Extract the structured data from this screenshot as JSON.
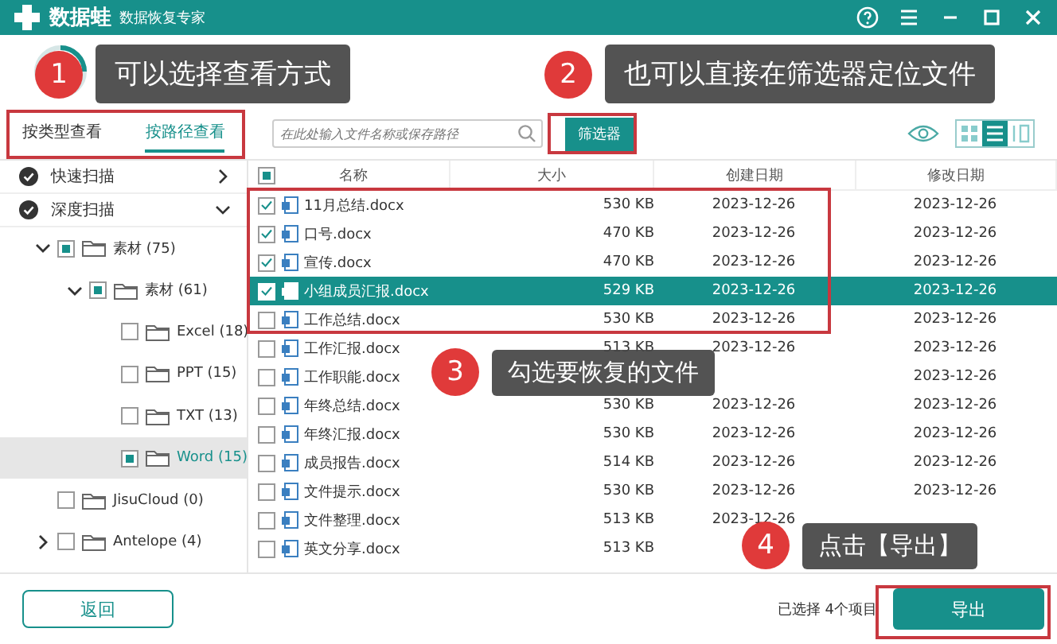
{
  "app": {
    "title": "数据蛙",
    "subtitle": "数据恢复专家"
  },
  "view_tabs": [
    {
      "label": "按类型查看",
      "selected": false
    },
    {
      "label": "按路径查看",
      "selected": true
    }
  ],
  "search": {
    "placeholder": "在此处输入文件名称或保存路径"
  },
  "filter_button": "筛选器",
  "view_modes": [
    {
      "kind": "grid",
      "selected": false
    },
    {
      "kind": "list",
      "selected": true
    },
    {
      "kind": "detail",
      "selected": false
    }
  ],
  "scans": [
    {
      "label": "快速扫描",
      "expanded": false
    },
    {
      "label": "深度扫描",
      "expanded": true
    }
  ],
  "tree": [
    {
      "label": "素材 (75)",
      "partial": true,
      "expanded": true,
      "selected": false,
      "children": [
        {
          "label": "素材 (61)",
          "partial": true,
          "expanded": true,
          "selected": false,
          "children": [
            {
              "label": "Excel (18)",
              "partial": false,
              "selected": false
            },
            {
              "label": "PPT (15)",
              "partial": false,
              "selected": false
            },
            {
              "label": "TXT (13)",
              "partial": false,
              "selected": false
            },
            {
              "label": "Word (15)",
              "partial": true,
              "selected": true
            }
          ]
        }
      ]
    },
    {
      "label": "JisuCloud (0)",
      "partial": false,
      "selected": false
    },
    {
      "label": "Antelope (4)",
      "partial": false,
      "expanded": false,
      "selected": false
    }
  ],
  "table": {
    "header_partial": true,
    "columns": [
      "名称",
      "大小",
      "创建日期",
      "修改日期"
    ],
    "rows": [
      {
        "name": "11月总结.docx",
        "size": "530 KB",
        "created": "2023-12-26",
        "modified": "2023-12-26",
        "checked": true,
        "selected": false
      },
      {
        "name": "口号.docx",
        "size": "470 KB",
        "created": "2023-12-26",
        "modified": "2023-12-26",
        "checked": true,
        "selected": false
      },
      {
        "name": "宣传.docx",
        "size": "470 KB",
        "created": "2023-12-26",
        "modified": "2023-12-26",
        "checked": true,
        "selected": false
      },
      {
        "name": "小组成员汇报.docx",
        "size": "529 KB",
        "created": "2023-12-26",
        "modified": "2023-12-26",
        "checked": true,
        "selected": true
      },
      {
        "name": "工作总结.docx",
        "size": "530 KB",
        "created": "2023-12-26",
        "modified": "2023-12-26",
        "checked": false,
        "selected": false
      },
      {
        "name": "工作汇报.docx",
        "size": "513 KB",
        "created": "2023-12-26",
        "modified": "2023-12-26",
        "checked": false,
        "selected": false
      },
      {
        "name": "工作职能.docx",
        "modified": "2023-12-26",
        "checked": false,
        "selected": false
      },
      {
        "name": "年终总结.docx",
        "size": "530 KB",
        "created": "2023-12-26",
        "modified": "2023-12-26",
        "checked": false,
        "selected": false
      },
      {
        "name": "年终汇报.docx",
        "size": "530 KB",
        "created": "2023-12-26",
        "modified": "2023-12-26",
        "checked": false,
        "selected": false
      },
      {
        "name": "成员报告.docx",
        "size": "514 KB",
        "created": "2023-12-26",
        "modified": "2023-12-26",
        "checked": false,
        "selected": false
      },
      {
        "name": "文件提示.docx",
        "size": "530 KB",
        "created": "2023-12-26",
        "modified": "2023-12-26",
        "checked": false,
        "selected": false
      },
      {
        "name": "文件整理.docx",
        "size": "513 KB",
        "created": "2023-12-26",
        "checked": false,
        "selected": false
      },
      {
        "name": "英文分享.docx",
        "size": "513 KB",
        "checked": false,
        "selected": false
      }
    ]
  },
  "footer": {
    "back_button": "返回",
    "status": "已选择 4个项目",
    "export_button": "导出"
  },
  "callouts": [
    {
      "number": "1",
      "text": "可以选择查看方式"
    },
    {
      "number": "2",
      "text": "也可以直接在筛选器定位文件"
    },
    {
      "number": "3",
      "text": "勾选要恢复的文件"
    },
    {
      "number": "4",
      "text": "点击【导出】"
    }
  ]
}
